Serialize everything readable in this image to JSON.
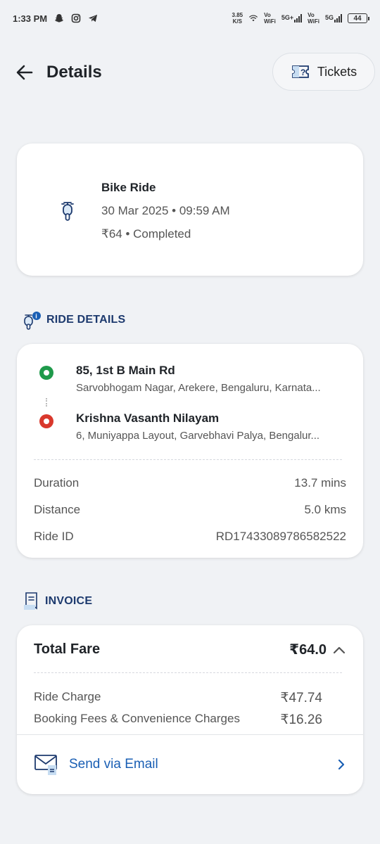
{
  "status_bar": {
    "time": "1:33 PM",
    "net_speed_value": "3.85",
    "net_speed_unit": "K/S",
    "vo_wifi_1_top": "Vo",
    "vo_wifi_1_bottom": "WiFi",
    "sig1_label": "5G+",
    "vo_wifi_2_top": "Vo",
    "vo_wifi_2_bottom": "WiFi",
    "sig2_label": "5G",
    "battery": "44"
  },
  "header": {
    "title": "Details",
    "tickets_label": "Tickets"
  },
  "summary": {
    "ride_type": "Bike Ride",
    "date_time": "30 Mar 2025 • 09:59 AM",
    "fare_status": "₹64 • Completed"
  },
  "ride_details": {
    "section_title": "RIDE DETAILS",
    "pickup_title": "85, 1st B Main Rd",
    "pickup_address": "Sarvobhogam Nagar, Arekere, Bengaluru, Karnata...",
    "drop_title": "Krishna Vasanth Nilayam",
    "drop_address": "6, Muniyappa Layout, Garvebhavi Palya, Bengalur...",
    "rows": [
      {
        "label": "Duration",
        "value": "13.7 mins"
      },
      {
        "label": "Distance",
        "value": "5.0 kms"
      },
      {
        "label": "Ride ID",
        "value": "RD17433089786582522"
      }
    ]
  },
  "invoice": {
    "section_title": "INVOICE",
    "total_label": "Total Fare",
    "total_value": "₹64.0",
    "charges": [
      {
        "label": "Ride Charge",
        "value": "₹47.74"
      },
      {
        "label": "Booking Fees & Convenience Charges",
        "value": "₹16.26"
      }
    ],
    "email_label": "Send via Email"
  },
  "colors": {
    "accent_blue": "#1a5fb4",
    "section_navy": "#1d3a6e",
    "pickup_green": "#1f9a4b",
    "drop_red": "#d9382c"
  }
}
